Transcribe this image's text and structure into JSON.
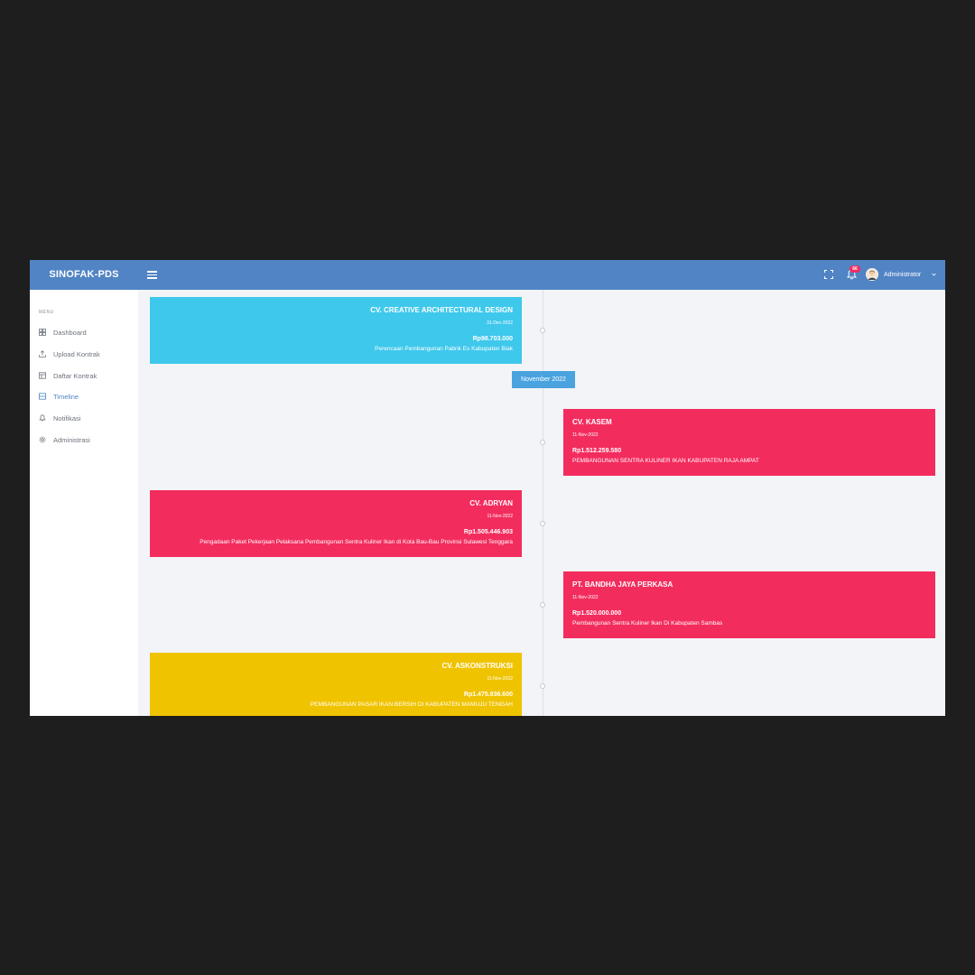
{
  "app": {
    "brand": "SINOFAK-PDS",
    "notification_count": "66",
    "user_name": "Administrator"
  },
  "colors": {
    "topbar": "#5184c4",
    "cyan": "#3ec8ec",
    "pink": "#f32c5e",
    "yellow": "#f0c300",
    "month_badge": "#4aa3df"
  },
  "sidebar": {
    "menu_title": "MENU",
    "items": [
      {
        "label": "Dashboard",
        "icon": "dashboard-icon"
      },
      {
        "label": "Upload Kontrak",
        "icon": "upload-icon"
      },
      {
        "label": "Daftar Kontrak",
        "icon": "list-icon"
      },
      {
        "label": "Timeline",
        "icon": "timeline-icon",
        "active": true
      },
      {
        "label": "Notifikasi",
        "icon": "bell-icon"
      },
      {
        "label": "Administrasi",
        "icon": "gear-icon"
      }
    ]
  },
  "timeline": {
    "month_label": "November 2022",
    "entries": [
      {
        "company": "CV. CREATIVE ARCHITECTURAL DESIGN",
        "date": "31-Dec-2022",
        "amount": "Rp98.703.000",
        "description": "Perencaan Pembangunan Pabrik Es Kabupaten Biak",
        "color": "#3ec8ec"
      },
      {
        "company": "CV. KASEM",
        "date": "11-Nov-2022",
        "amount": "Rp1.512.259.580",
        "description": "PEMBANGUNAN SENTRA KULINER IKAN KABUPATEN RAJA AMPAT",
        "color": "#f32c5e"
      },
      {
        "company": "CV. ADRYAN",
        "date": "11-Nov-2022",
        "amount": "Rp1.505.446.903",
        "description": "Pengadaan Paket Pekerjaan Pelaksana Pembangunan Sentra Kuliner Ikan di Kota Bau-Bau Provinsi Sulawesi Tenggara",
        "color": "#f32c5e"
      },
      {
        "company": "PT. BANDHA JAYA PERKASA",
        "date": "11-Nov-2022",
        "amount": "Rp1.520.000.000",
        "description": "Pembangunan Sentra Kuliner Ikan Di Kabupaten Sambas",
        "color": "#f32c5e"
      },
      {
        "company": "CV. ASKONSTRUKSI",
        "date": "11-Nov-2022",
        "amount": "Rp1.475.936.600",
        "description": "PEMBANGUNAN PASAR IKAN BERSIH DI KABUPATEN MAMUJU TENGAH",
        "color": "#f0c300"
      }
    ]
  }
}
